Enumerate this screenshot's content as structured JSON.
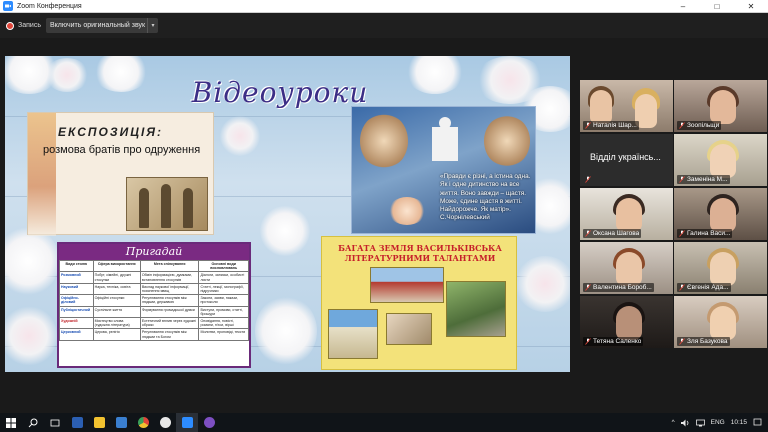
{
  "window": {
    "title": "Zoom Конференция"
  },
  "window_controls": {
    "minimize": "–",
    "maximize": "□",
    "close": "✕"
  },
  "toolbar": {
    "record_label": "Запись",
    "sound_label": "Включить оригинальный звук",
    "sound_caret": "▾"
  },
  "slide": {
    "title": "Відеоуроки",
    "exposition": {
      "title": "ЕКСПОЗИЦІЯ:",
      "subtitle": "розмова братів про одруження"
    },
    "quote": "«Правди є різні, а істина одна. Як і одне дитинство на все життя. Воно завжди – щастя. Може, єдине щастя в житті. Найдорожче. Як матір». С.Чорнілевський",
    "table": {
      "title": "Пригадай",
      "headers": [
        "Види стилю",
        "Сфера використання",
        "Мета спілкування",
        "Основні види висловлювань"
      ],
      "rows": [
        [
          "Розмовний",
          "Побут, сімейні, дружні стосунки",
          "Обмін інформацією, думками, встановлення стосунків",
          "Діалоги, записки, особисті листи"
        ],
        [
          "Науковий",
          "Наука, техніка, освіта",
          "Виклад наукової інформації, пояснення явищ",
          "Статті, лекції, монографії, підручники"
        ],
        [
          "Офіційно-діловий",
          "Офіційні стосунки",
          "Регулювання стосунків між людьми, державою",
          "Закони, заяви, накази, протоколи"
        ],
        [
          "Публіцистичний",
          "Суспільне життя",
          "Формування громадської думки",
          "Виступи, промови, статті, брошури"
        ],
        [
          "Художній",
          "Мистецтво слова (художня література)",
          "Естетичний вплив через художні образи",
          "Оповідання, повісті, романи, п'єси, вірші"
        ],
        [
          "Церковний",
          "Церква, релігія",
          "Регулювання стосунків між людьми та Богом",
          "Молитви, проповіді, тексти"
        ]
      ]
    },
    "land_title": "БАГАТА ЗЕМЛЯ ВАСИЛЬКІВСЬКА ЛІТЕРАТУРНИМИ ТАЛАНТАМИ"
  },
  "participants": [
    {
      "name": "Наталія Шар...",
      "active": true
    },
    {
      "name": "Зоопільщи",
      "active": false
    },
    {
      "name": "Відділ українсь...",
      "active": false,
      "text_only": true
    },
    {
      "name": "Заменіна М...",
      "active": false
    },
    {
      "name": "Оксана Шагова",
      "active": false
    },
    {
      "name": "Галина Васи...",
      "active": false
    },
    {
      "name": "Валентина Бороб...",
      "active": false
    },
    {
      "name": "Євгенія Ада...",
      "active": false
    },
    {
      "name": "Тетяна Саленко",
      "active": false
    },
    {
      "name": "Зля Базукова",
      "active": false
    }
  ],
  "taskbar": {
    "time": "10:15",
    "lang": "ENG",
    "tray_caret": "^"
  },
  "colors": {
    "accent": "#2d8cff",
    "active_speaker": "#b8e04a",
    "record": "#e0463a",
    "slide_title": "#3c2e86",
    "table_header": "#7a2a82",
    "land_title": "#c6202a"
  }
}
